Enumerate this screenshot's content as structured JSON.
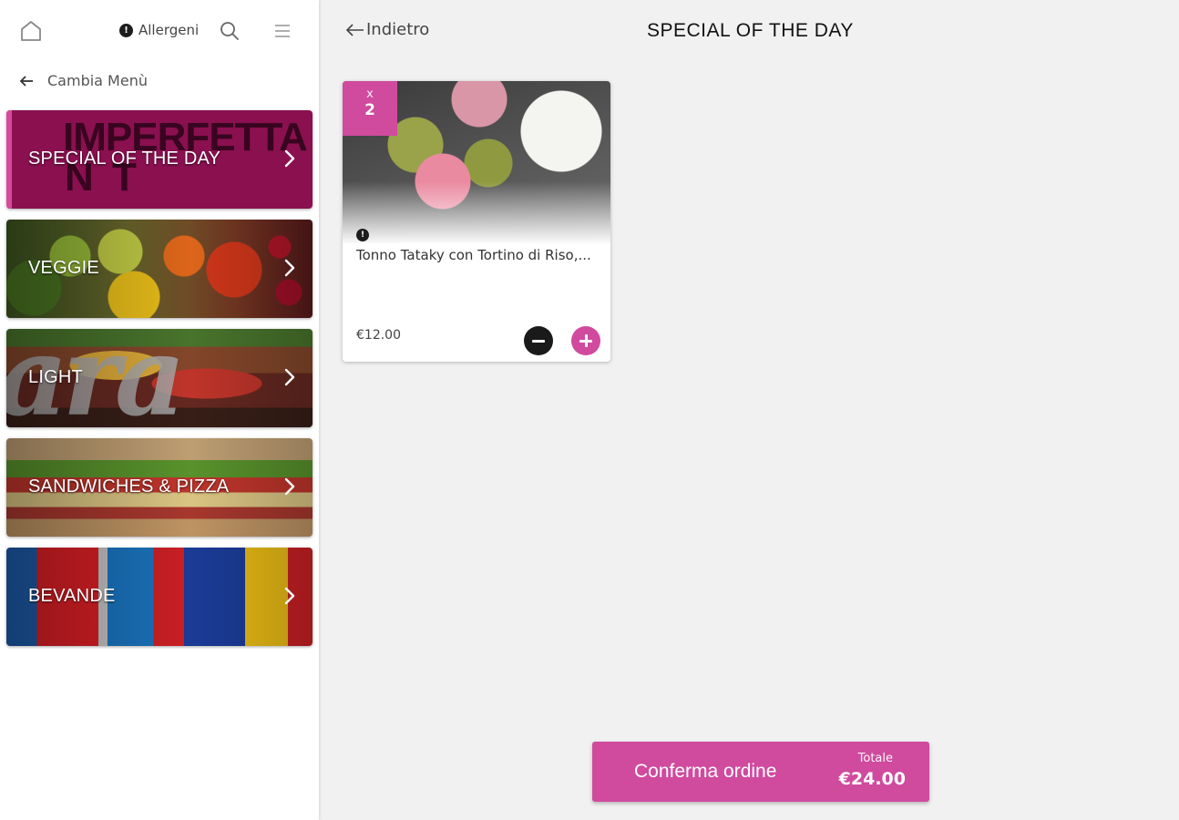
{
  "topbar": {
    "allergeni_label": "Allergeni",
    "info_glyph": "!"
  },
  "sidebar": {
    "cambia_label": "Cambia Menù",
    "special_logo_line1": "IMPERFETTA",
    "special_logo_line2": "N T",
    "light_script": "ara",
    "categories": [
      {
        "label": "SPECIAL OF THE DAY"
      },
      {
        "label": "VEGGIE"
      },
      {
        "label": "LIGHT"
      },
      {
        "label": "SANDWICHES & PIZZA"
      },
      {
        "label": "BEVANDE"
      }
    ]
  },
  "main": {
    "back_label": "Indietro",
    "title": "SPECIAL OF THE DAY",
    "product": {
      "qty_prefix": "x",
      "qty": "2",
      "info_glyph": "!",
      "name": "Tonno Tataky con Tortino di Riso,...",
      "price": "€12.00"
    },
    "confirm": {
      "label": "Conferma ordine",
      "total_label": "Totale",
      "total_value": "€24.00"
    }
  },
  "colors": {
    "accent": "#d04a9e",
    "special_bg": "#8a1050",
    "background": "#f1f1f1"
  },
  "icons": [
    "home-icon",
    "search-icon",
    "hamburger-menu-icon",
    "arrow-left-icon",
    "chevron-right-icon",
    "info-icon",
    "minus-icon",
    "plus-icon"
  ]
}
